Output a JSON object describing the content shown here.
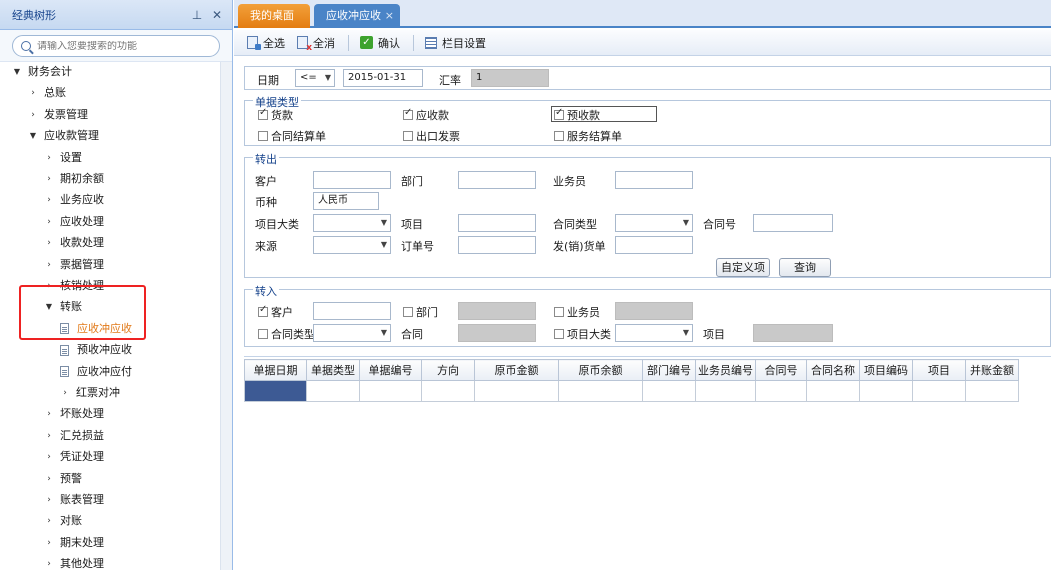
{
  "left_panel": {
    "title": "经典树形",
    "search_placeholder": "请输入您要搜索的功能",
    "tree": [
      {
        "label": "财务会计",
        "depth": 0,
        "state": "open"
      },
      {
        "label": "总账",
        "depth": 1,
        "state": "closed"
      },
      {
        "label": "发票管理",
        "depth": 1,
        "state": "closed"
      },
      {
        "label": "应收款管理",
        "depth": 1,
        "state": "open"
      },
      {
        "label": "设置",
        "depth": 2,
        "state": "closed"
      },
      {
        "label": "期初余额",
        "depth": 2,
        "state": "closed"
      },
      {
        "label": "业务应收",
        "depth": 2,
        "state": "closed"
      },
      {
        "label": "应收处理",
        "depth": 2,
        "state": "closed"
      },
      {
        "label": "收款处理",
        "depth": 2,
        "state": "closed"
      },
      {
        "label": "票据管理",
        "depth": 2,
        "state": "closed"
      },
      {
        "label": "核销处理",
        "depth": 2,
        "state": "closed"
      },
      {
        "label": "转账",
        "depth": 2,
        "state": "open"
      },
      {
        "label": "应收冲应收",
        "depth": 3,
        "state": "leaf",
        "active": true
      },
      {
        "label": "预收冲应收",
        "depth": 3,
        "state": "leaf"
      },
      {
        "label": "应收冲应付",
        "depth": 3,
        "state": "leaf"
      },
      {
        "label": "红票对冲",
        "depth": 3,
        "state": "closed"
      },
      {
        "label": "坏账处理",
        "depth": 2,
        "state": "closed"
      },
      {
        "label": "汇兑损益",
        "depth": 2,
        "state": "closed"
      },
      {
        "label": "凭证处理",
        "depth": 2,
        "state": "closed"
      },
      {
        "label": "预警",
        "depth": 2,
        "state": "closed"
      },
      {
        "label": "账表管理",
        "depth": 2,
        "state": "closed"
      },
      {
        "label": "对账",
        "depth": 2,
        "state": "closed"
      },
      {
        "label": "期末处理",
        "depth": 2,
        "state": "closed"
      },
      {
        "label": "其他处理",
        "depth": 2,
        "state": "closed"
      }
    ]
  },
  "tabs": {
    "home": "我的桌面",
    "active": "应收冲应收",
    "close": "×"
  },
  "toolbar": {
    "select_all": "全选",
    "unselect_all": "全消",
    "confirm": "确认",
    "columns": "栏目设置"
  },
  "form": {
    "date_label": "日期",
    "date_op": "<=",
    "date_value": "2015-01-31",
    "rate_label": "汇率",
    "rate_value": "1",
    "doc_type": {
      "legend": "单据类型",
      "goods": "货款",
      "receivable": "应收款",
      "prepay": "预收款",
      "contract_settle": "合同结算单",
      "export_invoice": "出口发票",
      "service_settle": "服务结算单"
    },
    "transfer_out": {
      "legend": "转出",
      "customer": "客户",
      "department": "部门",
      "salesman": "业务员",
      "currency": "币种",
      "currency_value": "人民币",
      "project_class": "项目大类",
      "project": "项目",
      "contract_type": "合同类型",
      "contract_no": "合同号",
      "source": "来源",
      "order_no": "订单号",
      "invoice_no": "发(销)货单",
      "custom_btn": "自定义项",
      "query_btn": "查询"
    },
    "transfer_in": {
      "legend": "转入",
      "customer": "客户",
      "department": "部门",
      "salesman": "业务员",
      "contract_type": "合同类型",
      "contract": "合同",
      "project_class": "项目大类",
      "project": "项目"
    }
  },
  "grid": {
    "columns": [
      "单据日期",
      "单据类型",
      "单据编号",
      "方向",
      "原币金额",
      "原币余额",
      "部门编号",
      "业务员编号",
      "合同号",
      "合同名称",
      "项目编码",
      "项目",
      "并账金额"
    ]
  }
}
